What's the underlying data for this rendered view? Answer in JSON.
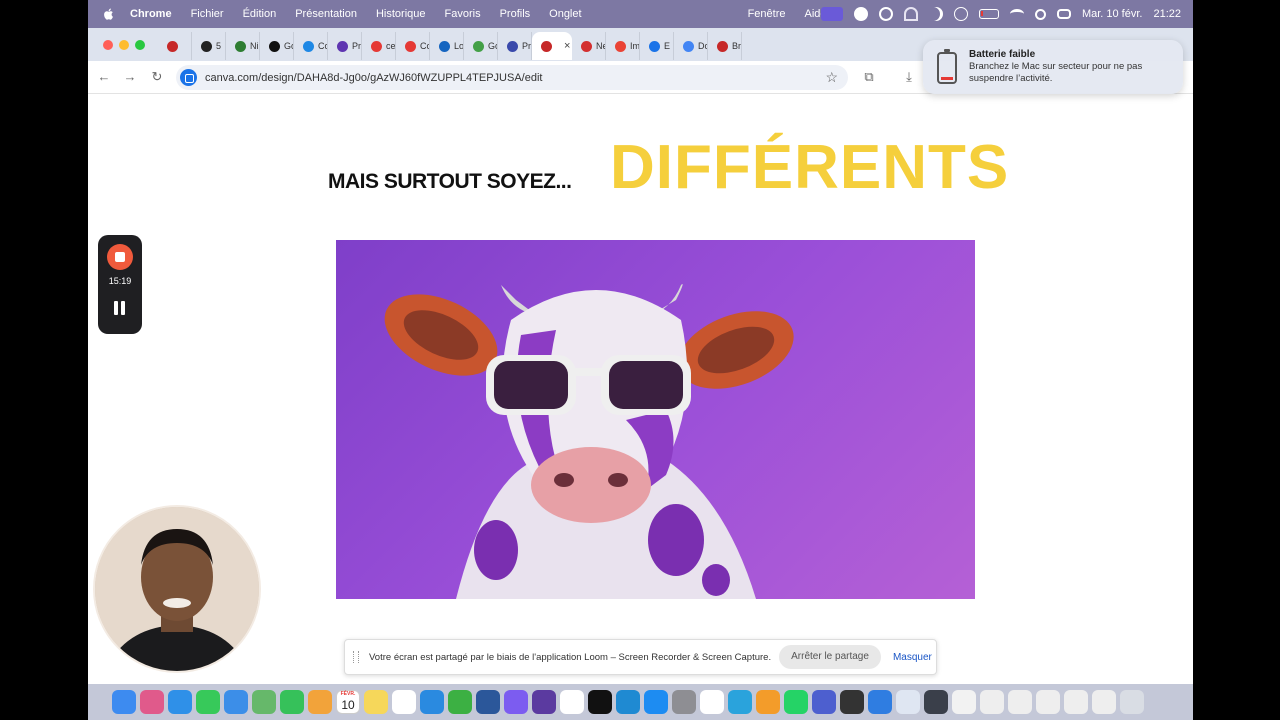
{
  "menubar": {
    "app_name": "Chrome",
    "items": [
      "Fichier",
      "Édition",
      "Présentation",
      "Historique",
      "Favoris",
      "Profils",
      "Onglet",
      "Fenêtre",
      "Aide"
    ],
    "date": "Mar. 10 févr.",
    "time": "21:22"
  },
  "tabs": [
    {
      "label": "",
      "color": "#c62828"
    },
    {
      "label": "5",
      "color": "#222222"
    },
    {
      "label": "Ni",
      "color": "#2e7d32"
    },
    {
      "label": "Go",
      "color": "#111111"
    },
    {
      "label": "Co",
      "color": "#1e88e5"
    },
    {
      "label": "Pr",
      "color": "#5e35b1"
    },
    {
      "label": "ce",
      "color": "#e53935"
    },
    {
      "label": "Co",
      "color": "#e53935"
    },
    {
      "label": "Lo",
      "color": "#1565c0"
    },
    {
      "label": "Go",
      "color": "#43a047"
    },
    {
      "label": "Pr",
      "color": "#3949ab"
    },
    {
      "label": "",
      "color": "#c62828",
      "active": true
    },
    {
      "label": "Ne",
      "color": "#d32f2f"
    },
    {
      "label": "Im",
      "color": "#ea4335"
    },
    {
      "label": "E",
      "color": "#1a73e8"
    },
    {
      "label": "Dc",
      "color": "#4285f4"
    },
    {
      "label": "Br",
      "color": "#c62828"
    }
  ],
  "address": {
    "url": "canva.com/design/DAHA8d-Jg0o/gAzWJ60fWZUPPL4TEPJUSA/edit"
  },
  "notification": {
    "title": "Batterie faible",
    "body": "Branchez le Mac sur secteur pour ne pas suspendre l’activité."
  },
  "slide": {
    "heading_small": "MAIS SURTOUT SOYEZ...",
    "heading_big": "DIFFÉRENTS",
    "image_alt": "Purple cow wearing white sunglasses"
  },
  "loom": {
    "timer": "15:19"
  },
  "sharebar": {
    "message": "Votre écran est partagé par le biais de l'application Loom – Screen Recorder & Screen Capture.",
    "stop_label": "Arrêter le partage",
    "hide_label": "Masquer"
  },
  "dock": {
    "calendar_day": "10",
    "calendar_month": "FÉVR.",
    "icons": [
      {
        "name": "finder",
        "color": "#3d8bf0"
      },
      {
        "name": "launchpad",
        "color": "#e05a8b"
      },
      {
        "name": "safari",
        "color": "#2f90e8"
      },
      {
        "name": "messages",
        "color": "#37c95a"
      },
      {
        "name": "mail",
        "color": "#3c8ee8"
      },
      {
        "name": "maps",
        "color": "#66b86a"
      },
      {
        "name": "facetime",
        "color": "#36c15a"
      },
      {
        "name": "photos",
        "color": "#f2a33a"
      },
      {
        "name": "calendar",
        "color": "#ffffff"
      },
      {
        "name": "notes",
        "color": "#f6d75a"
      },
      {
        "name": "freeform",
        "color": "#ffffff"
      },
      {
        "name": "keynote",
        "color": "#2a8ae0"
      },
      {
        "name": "numbers",
        "color": "#3cb043"
      },
      {
        "name": "word",
        "color": "#2b579a"
      },
      {
        "name": "canva",
        "color": "#7c5cf0"
      },
      {
        "name": "obsidian",
        "color": "#5b3aa0"
      },
      {
        "name": "chatgpt",
        "color": "#ffffff"
      },
      {
        "name": "capcut",
        "color": "#111111"
      },
      {
        "name": "vscode",
        "color": "#1f8ad2"
      },
      {
        "name": "appstore",
        "color": "#1d8cf2"
      },
      {
        "name": "settings",
        "color": "#8e8e93"
      },
      {
        "name": "chrome",
        "color": "#ffffff"
      },
      {
        "name": "telegram",
        "color": "#2aa3dc"
      },
      {
        "name": "pages",
        "color": "#f39c2a"
      },
      {
        "name": "whatsapp",
        "color": "#25d366"
      },
      {
        "name": "screen",
        "color": "#4d5fcf"
      },
      {
        "name": "loom",
        "color": "#333333"
      },
      {
        "name": "bluestack",
        "color": "#2f7de1"
      },
      {
        "name": "preview",
        "color": "#dfe6f2"
      },
      {
        "name": "quicktime",
        "color": "#3a3f4a"
      },
      {
        "name": "textedit",
        "color": "#f2f2f2"
      },
      {
        "name": "doc1",
        "color": "#eeeeee"
      },
      {
        "name": "doc2",
        "color": "#eeeeee"
      },
      {
        "name": "doc3",
        "color": "#eeeeee"
      },
      {
        "name": "doc4",
        "color": "#eeeeee"
      },
      {
        "name": "keyboard",
        "color": "#eeeeee"
      },
      {
        "name": "trash",
        "color": "#d9dde4"
      }
    ]
  }
}
